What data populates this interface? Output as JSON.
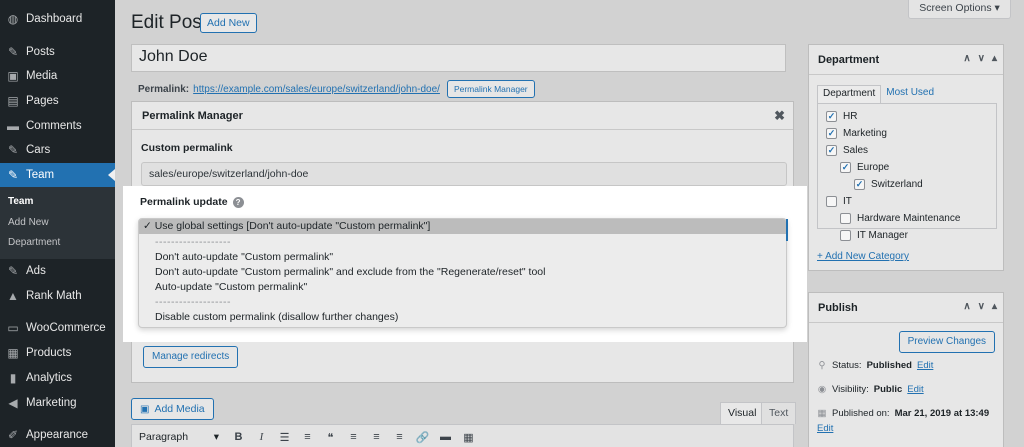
{
  "sidebar": {
    "items": [
      {
        "label": "Dashboard",
        "icon": "dashboard-icon",
        "glyph": "◍"
      },
      {
        "label": "Posts",
        "icon": "pin-icon",
        "glyph": "✎"
      },
      {
        "label": "Media",
        "icon": "media-icon",
        "glyph": "▣"
      },
      {
        "label": "Pages",
        "icon": "pages-icon",
        "glyph": "▤"
      },
      {
        "label": "Comments",
        "icon": "comment-icon",
        "glyph": "▬"
      },
      {
        "label": "Cars",
        "icon": "pin-icon",
        "glyph": "✎"
      },
      {
        "label": "Team",
        "icon": "pin-icon",
        "glyph": "✎"
      },
      {
        "label": "Ads",
        "icon": "pin-icon",
        "glyph": "✎"
      },
      {
        "label": "Rank Math",
        "icon": "rank-math-icon",
        "glyph": "▲"
      },
      {
        "label": "WooCommerce",
        "icon": "woocommerce-icon",
        "glyph": "▭"
      },
      {
        "label": "Products",
        "icon": "products-icon",
        "glyph": "▦"
      },
      {
        "label": "Analytics",
        "icon": "analytics-icon",
        "glyph": "▮"
      },
      {
        "label": "Marketing",
        "icon": "megaphone-icon",
        "glyph": "◀"
      },
      {
        "label": "Appearance",
        "icon": "paintbrush-icon",
        "glyph": "✐"
      }
    ],
    "submenu": [
      "Team",
      "Add New",
      "Department"
    ]
  },
  "header": {
    "title": "Edit Post",
    "add_new": "Add New",
    "screen_options": "Screen Options ▾"
  },
  "post": {
    "title": "John Doe",
    "permalink_label": "Permalink:",
    "permalink_url": "https://example.com/sales/europe/switzerland/john-doe/",
    "permalink_manager_button": "Permalink Manager"
  },
  "permalink_manager": {
    "title": "Permalink Manager",
    "close": "✖",
    "custom_permalink_label": "Custom permalink",
    "custom_permalink_value": "sales/europe/switzerland/john-doe",
    "permalink_update_label": "Permalink update",
    "help": "?",
    "options": [
      "✓ Use global settings [Don't auto-update \"Custom permalink\"]",
      "-------------------",
      "Don't auto-update \"Custom permalink\"",
      "Don't auto-update \"Custom permalink\" and exclude from the \"Regenerate/reset\" tool",
      "Auto-update \"Custom permalink\"",
      "-------------------",
      "Disable custom permalink (disallow further changes)"
    ],
    "manage_redirects": "Manage redirects"
  },
  "editor": {
    "add_media": "Add Media",
    "tab_visual": "Visual",
    "tab_text": "Text",
    "format_select": "Paragraph",
    "toolbar": [
      {
        "icon": "bold-icon",
        "glyph": "B"
      },
      {
        "icon": "italic-icon",
        "glyph": "I"
      },
      {
        "icon": "bullet-list-icon",
        "glyph": "☰"
      },
      {
        "icon": "numbered-list-icon",
        "glyph": "≡"
      },
      {
        "icon": "blockquote-icon",
        "glyph": "❝"
      },
      {
        "icon": "align-left-icon",
        "glyph": "≡"
      },
      {
        "icon": "align-center-icon",
        "glyph": "≡"
      },
      {
        "icon": "align-right-icon",
        "glyph": "≡"
      },
      {
        "icon": "link-icon",
        "glyph": "🔗"
      },
      {
        "icon": "more-icon",
        "glyph": "▬"
      },
      {
        "icon": "toolbar-toggle-icon",
        "glyph": "▦"
      }
    ]
  },
  "department": {
    "title": "Department",
    "tab_all": "Department",
    "tab_most_used": "Most Used",
    "categories": [
      {
        "label": "HR",
        "checked": true,
        "level": 0
      },
      {
        "label": "Marketing",
        "checked": true,
        "level": 0
      },
      {
        "label": "Sales",
        "checked": true,
        "level": 0
      },
      {
        "label": "Europe",
        "checked": true,
        "level": 1
      },
      {
        "label": "Switzerland",
        "checked": true,
        "level": 2
      },
      {
        "label": "IT",
        "checked": false,
        "level": 0
      },
      {
        "label": "Hardware Maintenance",
        "checked": false,
        "level": 1
      },
      {
        "label": "IT Manager",
        "checked": false,
        "level": 1
      }
    ],
    "add_new": "+ Add New Category"
  },
  "publish": {
    "title": "Publish",
    "preview_button": "Preview Changes",
    "status_label": "Status:",
    "status_value": "Published",
    "visibility_label": "Visibility:",
    "visibility_value": "Public",
    "published_label": "Published on:",
    "published_value": "Mar 21, 2019 at 13:49",
    "edit": "Edit"
  },
  "colors": {
    "sidebar_bg": "#1d2327",
    "accent": "#2271b1"
  }
}
